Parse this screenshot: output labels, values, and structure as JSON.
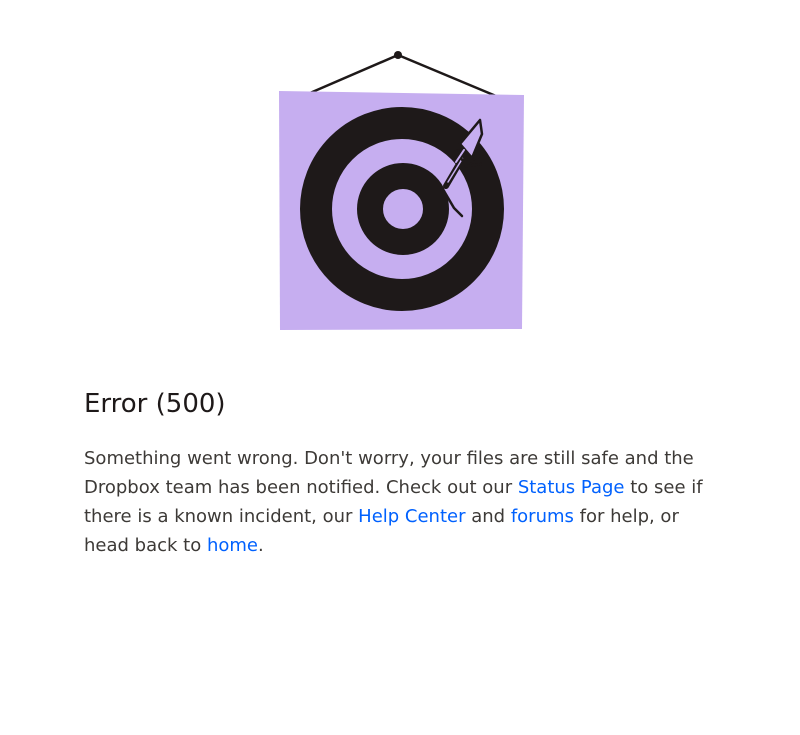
{
  "error": {
    "title": "Error (500)",
    "message": {
      "part1": "Something went wrong. Don't worry, your files are still safe and the Dropbox team has been notified. Check out our ",
      "status_link": "Status Page",
      "part2": " to see if there is a known incident, our ",
      "help_link": "Help Center",
      "part3": " and ",
      "forums_link": "forums",
      "part4": " for help, or head back to ",
      "home_link": "home",
      "part5": "."
    }
  },
  "colors": {
    "illustration_background": "#c6aef0",
    "target_ring": "#1e1919",
    "link": "#0061fe"
  },
  "illustration": {
    "icon": "target-dart-icon"
  }
}
